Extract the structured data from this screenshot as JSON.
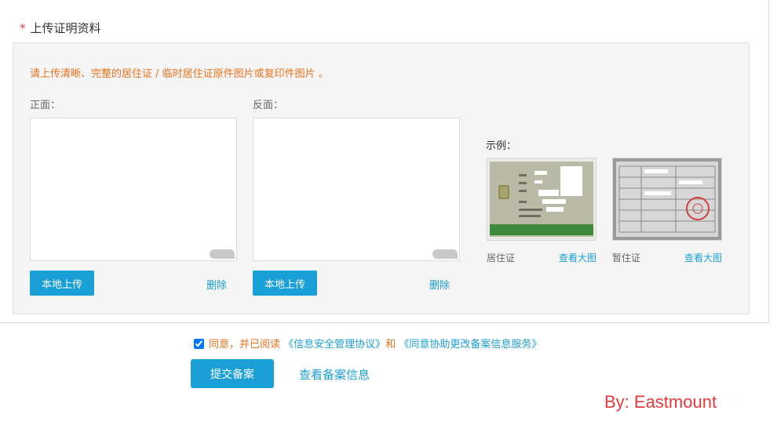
{
  "section": {
    "required_mark": "*",
    "title": "上传证明资料"
  },
  "notice": "请上传清晰、完整的居住证 / 临时居住证原件图片或复印件图片 。",
  "front": {
    "label": "正面：",
    "upload_label": "本地上传",
    "delete_label": "删除"
  },
  "back": {
    "label": "反面：",
    "upload_label": "本地上传",
    "delete_label": "删除"
  },
  "examples": {
    "label": "示例：",
    "items": [
      {
        "caption": "居住证",
        "link": "查看大图"
      },
      {
        "caption": "暂住证",
        "link": "查看大图"
      }
    ]
  },
  "agreement": {
    "checked": true,
    "prefix": "同意，并已阅读",
    "link1": "《信息安全管理协议》",
    "conjunction": "和",
    "link2": "《同意协助更改备案信息服务》"
  },
  "actions": {
    "submit_label": "提交备案",
    "view_label": "查看备案信息"
  },
  "watermark": "By: Eastmount",
  "colors": {
    "accent": "#1a9fd6",
    "warning": "#e8731c",
    "required": "#e4393c",
    "panel_bg": "#f5f5f5"
  }
}
